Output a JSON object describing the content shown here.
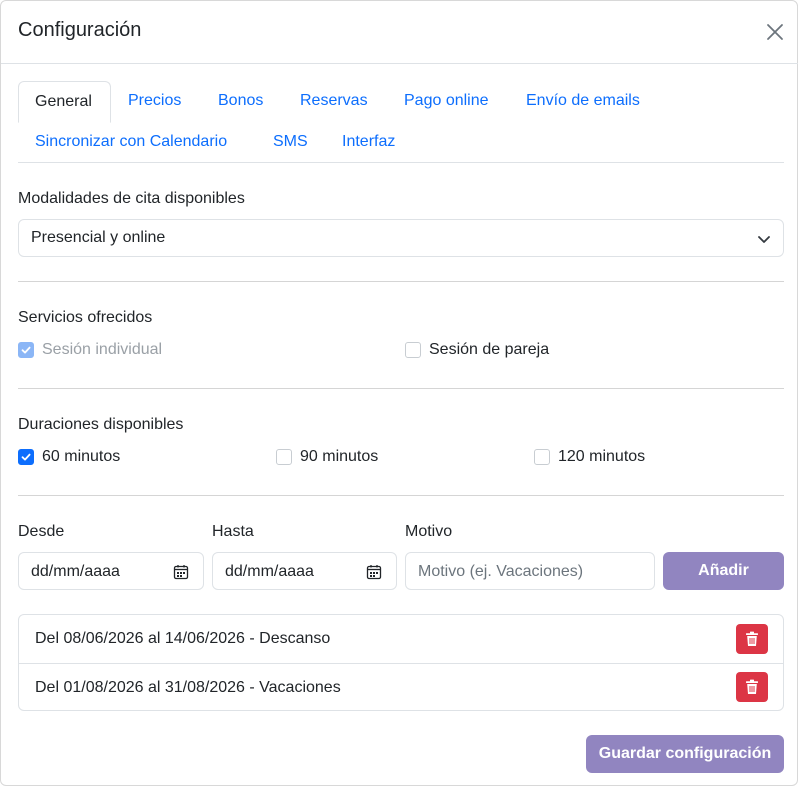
{
  "modal": {
    "title": "Configuración",
    "close_icon": "close-icon"
  },
  "tabs": [
    {
      "label": "General",
      "active": true
    },
    {
      "label": "Precios",
      "active": false
    },
    {
      "label": "Bonos",
      "active": false
    },
    {
      "label": "Reservas",
      "active": false
    },
    {
      "label": "Pago online",
      "active": false
    },
    {
      "label": "Envío de emails",
      "active": false
    },
    {
      "label": "Sincronizar con Calendario",
      "active": false
    },
    {
      "label": "SMS",
      "active": false
    },
    {
      "label": "Interfaz",
      "active": false
    }
  ],
  "modalidades": {
    "label": "Modalidades de cita disponibles",
    "selected": "Presencial y online",
    "icon": "chevron-down-icon"
  },
  "servicios": {
    "label": "Servicios ofrecidos",
    "items": [
      {
        "label": "Sesión individual",
        "checked": true,
        "disabled": true
      },
      {
        "label": "Sesión de pareja",
        "checked": false,
        "disabled": false
      }
    ]
  },
  "duraciones": {
    "label": "Duraciones disponibles",
    "items": [
      {
        "label": "60 minutos",
        "checked": true
      },
      {
        "label": "90 minutos",
        "checked": false
      },
      {
        "label": "120 minutos",
        "checked": false
      }
    ]
  },
  "ausencias": {
    "desde_label": "Desde",
    "desde_value": "dd/mm/aaaa",
    "hasta_label": "Hasta",
    "hasta_value": "dd/mm/aaaa",
    "motivo_label": "Motivo",
    "motivo_placeholder": "Motivo (ej. Vacaciones)",
    "add_button": "Añadir",
    "calendar_icon": "calendar-icon",
    "list": [
      {
        "text": "Del 08/06/2026 al 14/06/2026 - Descanso"
      },
      {
        "text": "Del 01/08/2026 al 31/08/2026 - Vacaciones"
      }
    ]
  },
  "footer": {
    "save_button": "Guardar configuración"
  },
  "colors": {
    "primary": "#0d6efd",
    "purple": "#9185c0",
    "danger": "#dc3545"
  }
}
